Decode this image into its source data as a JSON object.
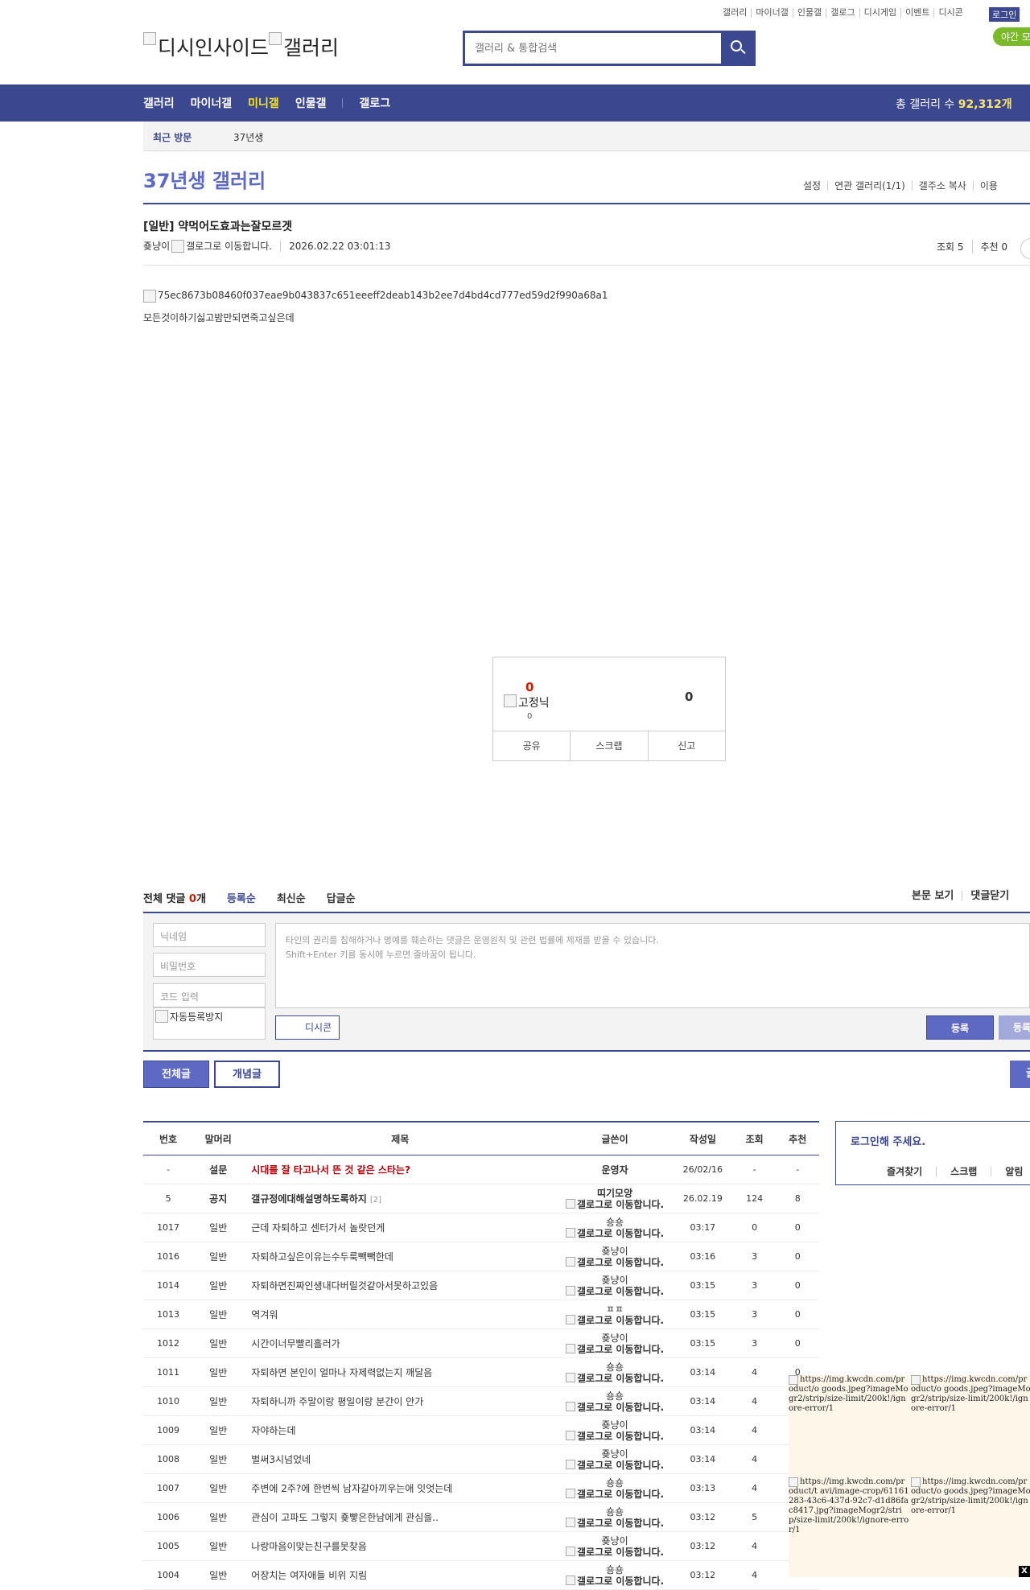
{
  "header": {
    "top_links": [
      "갤러리",
      "마이너갤",
      "인물갤",
      "갤로그",
      "디시게임",
      "이벤트",
      "디시콘"
    ],
    "login": "로그인",
    "night_mode": "야간 모",
    "logo_alt_1": "디시인사이드",
    "logo_alt_2": "갤러리",
    "search_placeholder": "갤러리 & 통합검색"
  },
  "nav": {
    "items": [
      "갤러리",
      "마이너갤",
      "미니갤",
      "인물갤",
      "갤로그"
    ],
    "selected": "미니갤",
    "total_label": "총 갤러리 수 ",
    "total_value": "92,312개"
  },
  "recent": {
    "label": "최근 방문",
    "value": "37년생"
  },
  "gallery": {
    "title": "37년생 갤러리",
    "links": [
      "설정",
      "연관 갤러리(1/1)",
      "갤주소 복사",
      "이용"
    ]
  },
  "post": {
    "title": "[일반] 약먹어도효과는잘모르겟",
    "author": "죶냥이",
    "gallog_alt": "갤로그로 이동합니다.",
    "date": "2026.02.22 03:01:13",
    "views": "조회 5",
    "recommends": "추천 0",
    "image_alt": "75ec8673b08460f037eae9b043837c651eeeff2deab143b2ee7d4bd4cd777ed59d2f990a68a1",
    "body": "모든것이하기싫고밤만되면죽고싶은데"
  },
  "recommend": {
    "up": "0",
    "fix_alt": "고정닉",
    "fix_count": "0",
    "down": "0",
    "actions": [
      "공유",
      "스크랩",
      "신고"
    ]
  },
  "comments": {
    "total_label": "전체 댓글 ",
    "total_count": "0",
    "total_unit": "개",
    "sorts": [
      "등록순",
      "최신순",
      "답글순"
    ],
    "right": [
      "본문 보기",
      "댓글닫기"
    ],
    "nickname_placeholder": "닉네임",
    "password_placeholder": "비밀번호",
    "code_placeholder": "코드 입력",
    "captcha_alt": "자동등록방지",
    "textarea_line1": "타인의 권리를 침해하거나 명예를 훼손하는 댓글은 운영원칙 및 관련 법률에 제재를 받을 수 있습니다.",
    "textarea_line2": "Shift+Enter 키를 동시에 누르면 줄바꿈이 됩니다.",
    "dccon": "디시콘",
    "register": "등록",
    "register2": "등록"
  },
  "tabs": {
    "all": "전체글",
    "best": "개념글",
    "write": "글"
  },
  "list": {
    "headers": [
      "번호",
      "말머리",
      "제목",
      "글쓴이",
      "작성일",
      "조회",
      "추천"
    ],
    "gallog_alt": "갤로그로 이동합니다.",
    "rows": [
      {
        "num": "-",
        "head": "설문",
        "subj": "시대를 잘 타고나서 뜬 것 같은 스타는?",
        "reply": "",
        "writer": "운영자",
        "ip": "",
        "date": "26/02/16",
        "views": "-",
        "rec": "-",
        "type": "survey"
      },
      {
        "num": "5",
        "head": "공지",
        "subj": "갤규정에대해설명하도록하지",
        "reply": "[2]",
        "writer": "띠기모앙",
        "ip": "갤로그로 이동합니다.",
        "date": "26.02.19",
        "views": "124",
        "rec": "8",
        "type": "notice"
      },
      {
        "num": "1017",
        "head": "일반",
        "subj": "근데 자퇴하고 센터가서 놀랏던게",
        "reply": "",
        "writer": "숑숑",
        "ip": "갤로그로 이동합니다.",
        "date": "03:17",
        "views": "0",
        "rec": "0",
        "type": "normal"
      },
      {
        "num": "1016",
        "head": "일반",
        "subj": "자퇴하고싶은이유는수두룩빽빽한데",
        "reply": "",
        "writer": "죶냥이",
        "ip": "갤로그로 이동합니다.",
        "date": "03:16",
        "views": "3",
        "rec": "0",
        "type": "normal"
      },
      {
        "num": "1014",
        "head": "일반",
        "subj": "자퇴하면진짜인생내다버릴것같아서못하고있음",
        "reply": "",
        "writer": "죶냥이",
        "ip": "갤로그로 이동합니다.",
        "date": "03:15",
        "views": "3",
        "rec": "0",
        "type": "normal"
      },
      {
        "num": "1013",
        "head": "일반",
        "subj": "역겨워",
        "reply": "",
        "writer": "ㅍㅍ",
        "ip": "갤로그로 이동합니다.",
        "date": "03:15",
        "views": "3",
        "rec": "0",
        "type": "normal"
      },
      {
        "num": "1012",
        "head": "일반",
        "subj": "시간이너무빨리흘러가",
        "reply": "",
        "writer": "죶냥이",
        "ip": "갤로그로 이동합니다.",
        "date": "03:15",
        "views": "3",
        "rec": "0",
        "type": "normal"
      },
      {
        "num": "1011",
        "head": "일반",
        "subj": "자퇴하면 본인이 얼마나 자제력없는지 깨달음",
        "reply": "",
        "writer": "숑숑",
        "ip": "갤로그로 이동합니다.",
        "date": "03:14",
        "views": "4",
        "rec": "0",
        "type": "normal"
      },
      {
        "num": "1010",
        "head": "일반",
        "subj": "자퇴하니까 주말이랑 평일이랑 분간이 안가",
        "reply": "",
        "writer": "숑숑",
        "ip": "갤로그로 이동합니다.",
        "date": "03:14",
        "views": "4",
        "rec": "",
        "type": "normal"
      },
      {
        "num": "1009",
        "head": "일반",
        "subj": "자야하는데",
        "reply": "",
        "writer": "죶냥이",
        "ip": "갤로그로 이동합니다.",
        "date": "03:14",
        "views": "4",
        "rec": "",
        "type": "normal"
      },
      {
        "num": "1008",
        "head": "일반",
        "subj": "벌써3시넘었네",
        "reply": "",
        "writer": "죶냥이",
        "ip": "갤로그로 이동합니다.",
        "date": "03:14",
        "views": "4",
        "rec": "",
        "type": "normal"
      },
      {
        "num": "1007",
        "head": "일반",
        "subj": "주변에 2주?에 한번씩 남자갈아끼우는애 잇엇는데",
        "reply": "",
        "writer": "숑숑",
        "ip": "갤로그로 이동합니다.",
        "date": "03:13",
        "views": "4",
        "rec": "",
        "type": "normal"
      },
      {
        "num": "1006",
        "head": "일반",
        "subj": "관심이 고파도 그렇지 죶빻은한남에게 관심을..",
        "reply": "",
        "writer": "숑숑",
        "ip": "갤로그로 이동합니다.",
        "date": "03:12",
        "views": "5",
        "rec": "",
        "type": "normal"
      },
      {
        "num": "1005",
        "head": "일반",
        "subj": "나랑마음이맞는친구를못찾음",
        "reply": "",
        "writer": "죶냥이",
        "ip": "갤로그로 이동합니다.",
        "date": "03:12",
        "views": "4",
        "rec": "",
        "type": "normal"
      },
      {
        "num": "1004",
        "head": "일반",
        "subj": "어장치는 여자애들 비위 지림",
        "reply": "",
        "writer": "숑숑",
        "ip": "갤로그로 이동합니다.",
        "date": "03:12",
        "views": "4",
        "rec": "",
        "type": "normal"
      }
    ]
  },
  "login_box": {
    "title": "로그인해 주세요.",
    "actions": [
      "즐겨찾기",
      "스크랩",
      "알림"
    ]
  },
  "ads": {
    "a1": "https://img.kwcdn.com/product/o goods.jpeg?imageMogr2/strip/size-limit/200k!/ignore-error/1",
    "a2": "https://img.kwcdn.com/product/o goods.jpeg?imageMogr2/strip/size-limit/200k!/ignore-error/1",
    "a3": "https://img.kwcdn.com/product/t avi/image-crop/61161283-43c6-437d-92c7-d1d86fac8417.jpg?imageMogr2/strip/size-limit/200k!/ignore-error/1",
    "a4": "https://img.kwcdn.com/product/o goods.jpeg?imageMogr2/strip/size-limit/200k!/ignore-error/1",
    "close": "X"
  }
}
